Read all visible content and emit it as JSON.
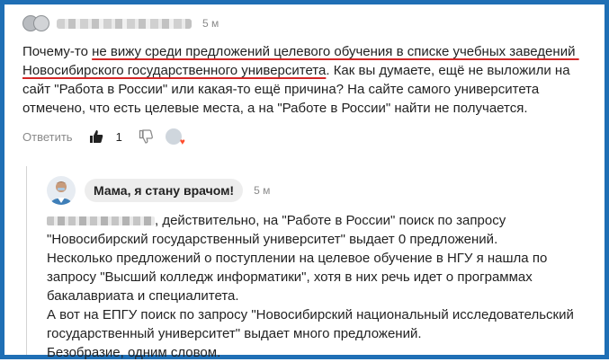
{
  "comment": {
    "time": "5 м",
    "text_before": "Почему-то ",
    "text_underlined": "не вижу среди предложений целевого обучения в списке учебных заведений Новосибирского государственного университета",
    "text_after": ". Как вы думаете, ещё не выложили на сайт \"Работа в России\" или какая-то ещё причина? На сайте самого университета отмечено, что есть целевые места, а на \"Работе в России\" найти не получается.",
    "reply_label": "Ответить",
    "like_count": "1",
    "icons": [
      "thumbs-up-icon",
      "thumbs-down-icon",
      "reaction-avatar-icon"
    ]
  },
  "reply": {
    "author": "Мама, я стану врачом!",
    "time": "5 м",
    "text_start": ", действительно, на \"Работе в России\" поиск по запросу \"Новосибирский государственный университет\" выдает 0 предложений.\nНесколько предложений о поступлении на целевое обучение в НГУ я нашла по запросу \"Высший колледж информатики\", хотя в них речь идет о программах бакалавриата и специалитета.\nА вот на ЕПГУ поиск по запросу \"Новосибирский национальный исследовательский государственный университет\" выдает много предложений.\nБезобразие, одним словом."
  },
  "colors": {
    "frame": "#1f6fb5",
    "underline": "#d32727",
    "heart": "#ff4d2d"
  }
}
